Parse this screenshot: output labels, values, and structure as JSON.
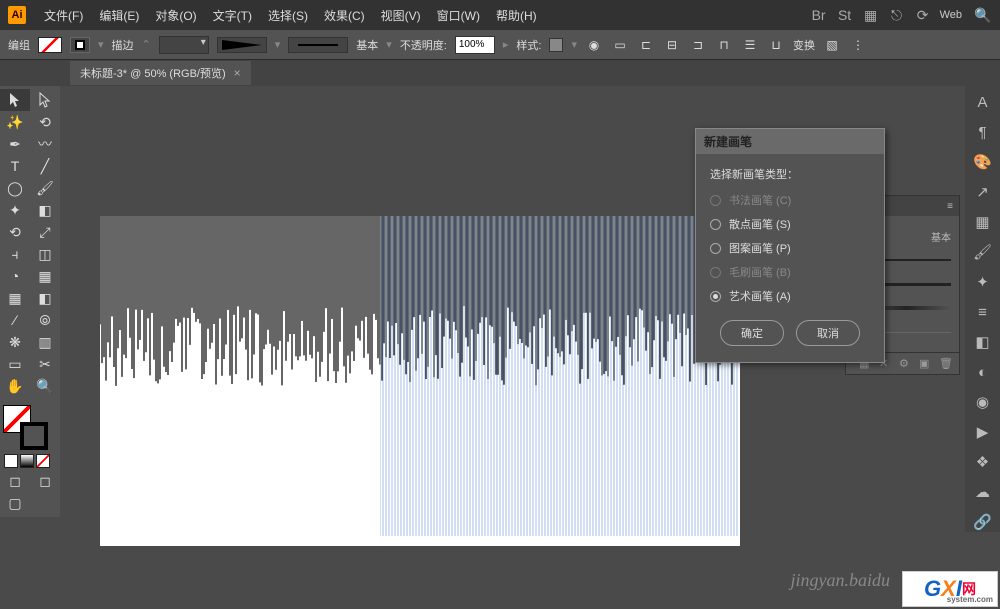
{
  "menubar": {
    "items": [
      "文件(F)",
      "编辑(E)",
      "对象(O)",
      "文字(T)",
      "选择(S)",
      "效果(C)",
      "视图(V)",
      "窗口(W)",
      "帮助(H)"
    ],
    "workspace_label": "Web"
  },
  "controlbar": {
    "group_label": "编组",
    "stroke_label": "描边",
    "stroke_weight": "",
    "basic_label": "基本",
    "opacity_label": "不透明度:",
    "opacity_value": "100%",
    "style_label": "样式:",
    "transform_label": "变换"
  },
  "document": {
    "tab_title": "未标题-3* @ 50% (RGB/预览)"
  },
  "dialog": {
    "title": "新建画笔",
    "prompt": "选择新画笔类型：",
    "options": [
      {
        "label": "书法画笔 (C)",
        "enabled": false,
        "selected": false
      },
      {
        "label": "散点画笔 (S)",
        "enabled": true,
        "selected": false
      },
      {
        "label": "图案画笔 (P)",
        "enabled": true,
        "selected": false
      },
      {
        "label": "毛刷画笔 (B)",
        "enabled": false,
        "selected": false
      },
      {
        "label": "艺术画笔 (A)",
        "enabled": true,
        "selected": true
      }
    ],
    "ok": "确定",
    "cancel": "取消"
  },
  "brushes_panel": {
    "basic_label": "基本",
    "expand": "»"
  },
  "watermark": "jingyan.baidu",
  "gxi": {
    "domain": "system.com",
    "text": "网"
  }
}
